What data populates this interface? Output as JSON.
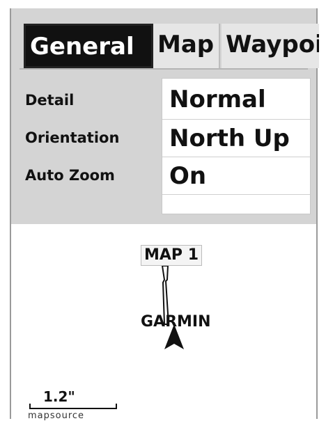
{
  "tabs": [
    {
      "label": "General",
      "active": true
    },
    {
      "label": "Map",
      "active": false
    },
    {
      "label": "Waypoin:",
      "active": false
    }
  ],
  "settings": [
    {
      "label": "Detail",
      "value": "Normal"
    },
    {
      "label": "Orientation",
      "value": "North Up"
    },
    {
      "label": "Auto Zoom",
      "value": "On"
    }
  ],
  "map": {
    "waypoint_label": "MAP 1",
    "city_label": "GARMIN",
    "scale": "1.2\"",
    "footer": "mapsource"
  },
  "icons": [
    "position-arrow-icon",
    "road-icon"
  ]
}
